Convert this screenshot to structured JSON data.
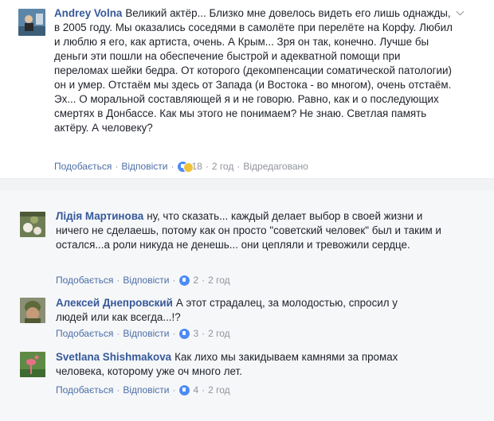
{
  "comments": [
    {
      "author": "Andrey Volna",
      "text": "Великий актёр... Близко мне довелось видеть его лишь однажды, в 2005 году. Мы оказались соседями в самолёте при перелёте на Корфу. Любил и люблю я его, как артиста, очень. А Крым... Зря он так, конечно. Лучше бы деньги эти пошли на обеспечение быстрой и адекватной помощи при переломах шейки бедра. От которого (декомпенсации соматической патологии) он и умер. Отстаём мы здесь от Запада (и Востока - во многом), очень отстаём. Эх... О моральной составляющей я и не говорю. Равно, как и о последующих смертях в Донбассе. Как мы этого не понимаем? Не знаю. Светлая память актёру. А человеку?",
      "like": "Подобається",
      "reply": "Відповісти",
      "reactions": "18",
      "time": "2 год",
      "edited": "Відредаговано"
    },
    {
      "author": "Лідія Мартинова",
      "text": "ну, что сказать... каждый делает выбор в своей жизни и ничего не сделаешь, потому как он просто \"советский человек\" был и таким и остался...а роли никуда не денешь... они цепляли и тревожили сердце.",
      "like": "Подобається",
      "reply": "Відповісти",
      "reactions": "2",
      "time": "2 год"
    },
    {
      "author": "Алексей Днепровский",
      "text": "А этот страдалец, за молодостью, спросил у людей или как всегда...!?",
      "like": "Подобається",
      "reply": "Відповісти",
      "reactions": "3",
      "time": "2 год"
    },
    {
      "author": "Svetlana Shishmakova",
      "text": "Как лихо мы закидываем камнями за промах человека, которому уже оч много лет.",
      "like": "Подобається",
      "reply": "Відповісти",
      "reactions": "4",
      "time": "2 год"
    }
  ],
  "colors": {
    "author": "#365899",
    "meta": "#90949c",
    "link": "#4b6ea6",
    "reply_bg": "#f6f7f9"
  },
  "icons": [
    "chevron-down-icon",
    "like-reaction-icon",
    "haha-reaction-icon"
  ]
}
